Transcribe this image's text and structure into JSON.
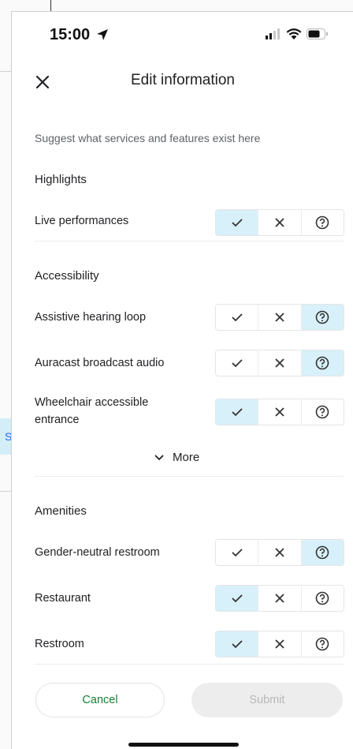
{
  "background": {
    "chip_letter": "S"
  },
  "status_bar": {
    "time": "15:00"
  },
  "header": {
    "title": "Edit information"
  },
  "subtitle": "Suggest what services and features exist here",
  "sections": {
    "highlights": {
      "title": "Highlights"
    },
    "accessibility": {
      "title": "Accessibility"
    },
    "amenities": {
      "title": "Amenities"
    }
  },
  "rows": [
    {
      "label": "Live performances",
      "selected": "yes"
    },
    {
      "label": "Assistive hearing loop",
      "selected": "unsure"
    },
    {
      "label": "Auracast broadcast audio",
      "selected": "unsure"
    },
    {
      "label": "Wheelchair accessible entrance",
      "selected": "yes"
    },
    {
      "label": "Gender-neutral restroom",
      "selected": "unsure"
    },
    {
      "label": "Restaurant",
      "selected": "yes"
    },
    {
      "label": "Restroom",
      "selected": "yes"
    }
  ],
  "more": {
    "label": "More"
  },
  "footer": {
    "cancel_label": "Cancel",
    "submit_label": "Submit"
  },
  "colors": {
    "selected_bg": "#d8f0fa",
    "accent_green": "#188038",
    "submit_disabled_bg": "#ededed"
  },
  "icons": {
    "yes": "check-icon",
    "no": "x-icon",
    "unsure": "question-circle-icon"
  }
}
